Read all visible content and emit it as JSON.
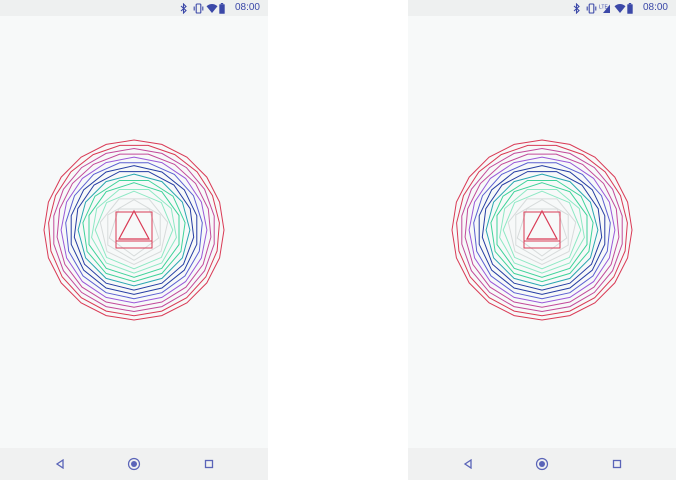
{
  "screens": [
    {
      "status_bar": {
        "time": "08:00",
        "icons": [
          "bluetooth-icon",
          "vibrate-icon",
          "wifi-icon",
          "battery-icon"
        ]
      },
      "nav_bar": {
        "icons": [
          "back-icon",
          "home-icon",
          "recents-icon"
        ]
      }
    },
    {
      "status_bar": {
        "time": "08:00",
        "network_label": "LTE",
        "icons": [
          "bluetooth-icon",
          "vibrate-icon",
          "cellular-lte-icon",
          "wifi-icon",
          "battery-icon"
        ]
      },
      "nav_bar": {
        "icons": [
          "back-icon",
          "home-icon",
          "recents-icon"
        ]
      }
    }
  ],
  "drawing": {
    "description_sides": [
      20,
      19,
      18,
      17,
      16,
      15,
      14,
      13,
      12,
      11,
      10,
      9,
      8,
      7,
      6,
      5,
      4,
      3
    ],
    "colors": {
      "outer": "#d93a55",
      "magenta": "#c24a9a",
      "purple": "#9a5ad8",
      "indigo": "#5b5fd1",
      "navy": "#253da3",
      "teal": "#2aa6b0",
      "green": "#3fd39a",
      "lightgreen": "#8ee8c4",
      "gray": "#d7dbdb",
      "inner": "#d93a55"
    },
    "theme": {
      "status_text": "#3b48a8",
      "background": "#f7f9f9",
      "bar_background": "#eef0f0"
    }
  }
}
